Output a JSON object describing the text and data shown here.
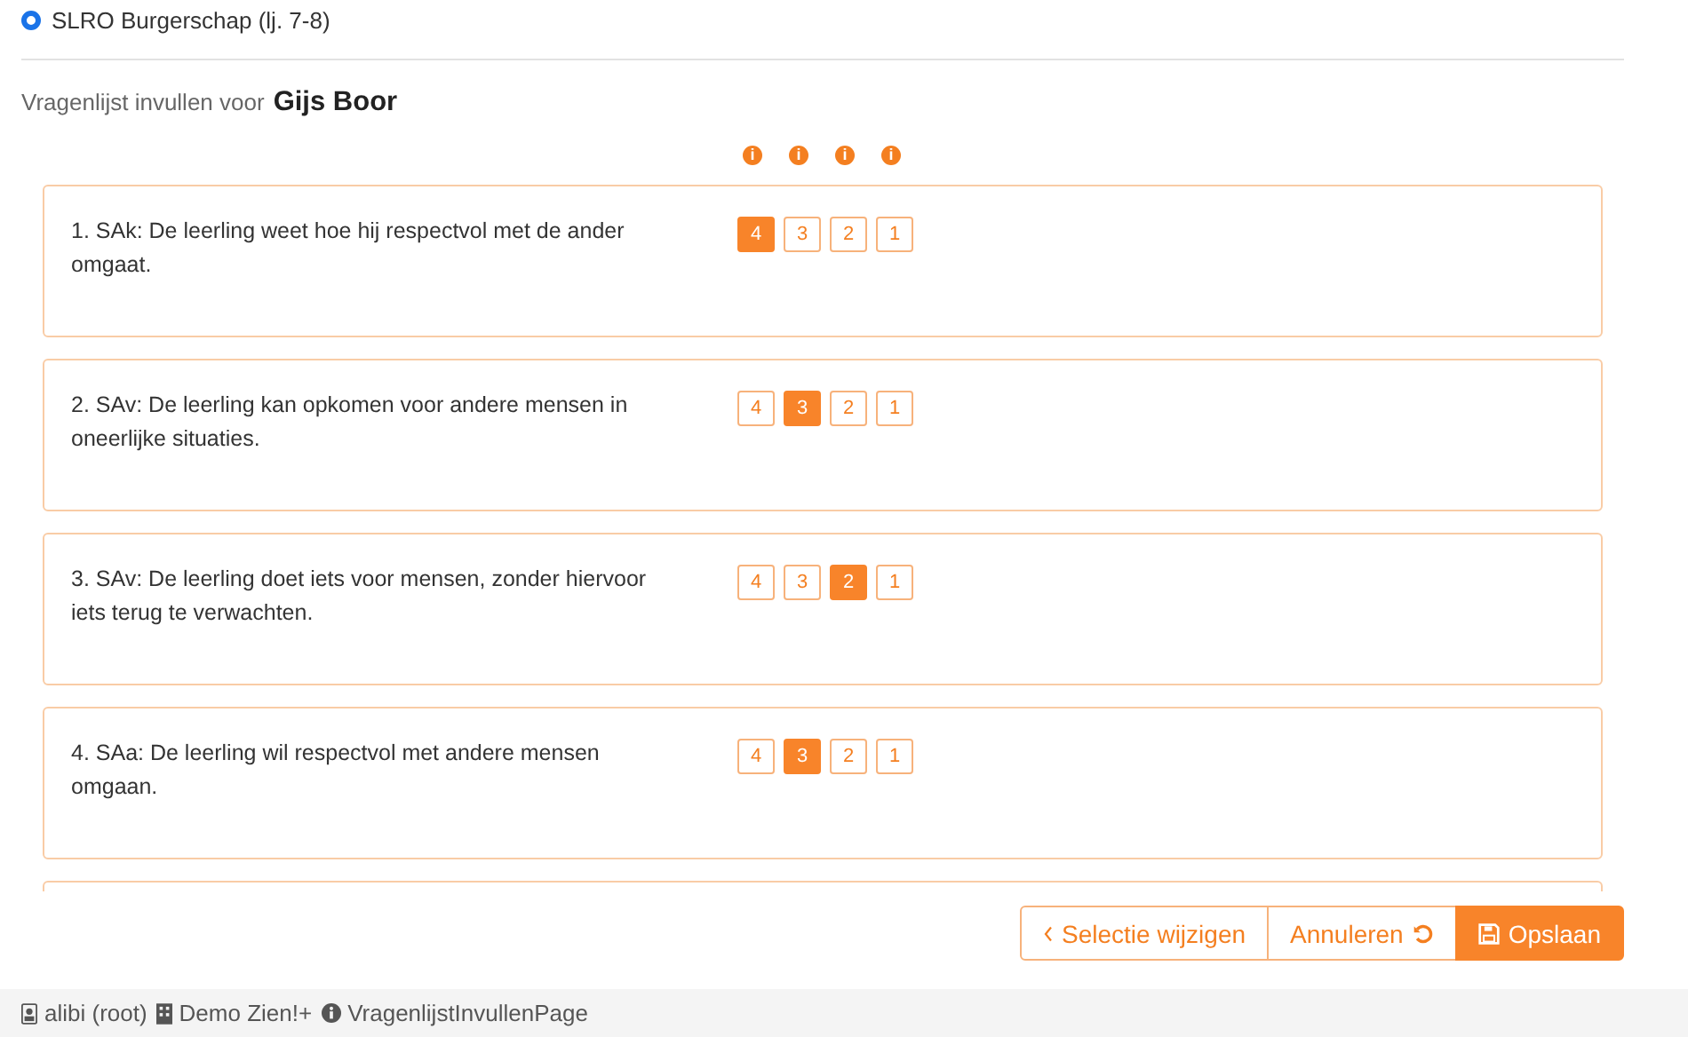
{
  "radio_option": {
    "label": "SLRO Burgerschap (lj. 7-8)",
    "selected": true
  },
  "heading": {
    "prefix": "Vragenlijst invullen voor",
    "name": "Gijs Boor"
  },
  "info_icon_count_labels": [
    "i",
    "i",
    "i",
    "i"
  ],
  "questions": [
    {
      "text": "1. SAk: De leerling weet hoe hij respectvol met de ander omgaat.",
      "options": [
        {
          "label": "4",
          "selected": true
        },
        {
          "label": "3",
          "selected": false
        },
        {
          "label": "2",
          "selected": false
        },
        {
          "label": "1",
          "selected": false
        }
      ]
    },
    {
      "text": "2. SAv: De leerling kan opkomen voor andere mensen in oneerlijke situaties.",
      "options": [
        {
          "label": "4",
          "selected": false
        },
        {
          "label": "3",
          "selected": true
        },
        {
          "label": "2",
          "selected": false
        },
        {
          "label": "1",
          "selected": false
        }
      ]
    },
    {
      "text": "3. SAv: De leerling doet iets voor mensen, zonder hiervoor iets terug te verwachten.",
      "options": [
        {
          "label": "4",
          "selected": false
        },
        {
          "label": "3",
          "selected": false
        },
        {
          "label": "2",
          "selected": true
        },
        {
          "label": "1",
          "selected": false
        }
      ]
    },
    {
      "text": "4. SAa: De leerling wil respectvol met andere mensen omgaan.",
      "options": [
        {
          "label": "4",
          "selected": false
        },
        {
          "label": "3",
          "selected": true
        },
        {
          "label": "2",
          "selected": false
        },
        {
          "label": "1",
          "selected": false
        }
      ]
    }
  ],
  "buttons": [
    {
      "kind": "back",
      "label": "Selectie wijzigen"
    },
    {
      "kind": "cancel",
      "label": "Annuleren"
    },
    {
      "kind": "save",
      "label": "Opslaan"
    }
  ],
  "status_bar": [
    {
      "kind": "user",
      "label": "alibi (root)"
    },
    {
      "kind": "org",
      "label": "Demo Zien!+"
    },
    {
      "kind": "info",
      "label": "VragenlijstInvullenPage"
    }
  ]
}
